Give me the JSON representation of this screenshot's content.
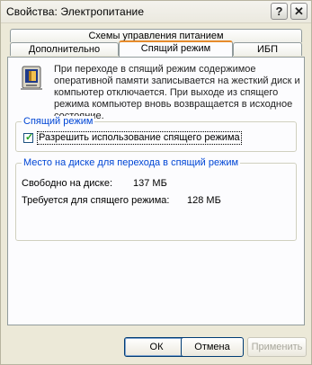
{
  "window": {
    "title": "Свойства: Электропитание",
    "help_glyph": "?",
    "close_glyph": "✕"
  },
  "tabs": {
    "row1": [
      {
        "label": "Схемы управления питанием"
      }
    ],
    "row2": [
      {
        "label": "Дополнительно"
      },
      {
        "label": "Спящий режим"
      },
      {
        "label": "ИБП"
      }
    ],
    "active": "Спящий режим"
  },
  "description": "При переходе в спящий режим содержимое оперативной памяти записывается на жесткий диск и компьютер отключается. При выходе из спящего режима компьютер вновь возвращается в исходное состояние.",
  "hibernate_group": {
    "title": "Спящий режим",
    "checkbox_label": "Разрешить использование спящего режима",
    "checked": true
  },
  "disk_group": {
    "title": "Место на диске для перехода в спящий режим",
    "free_label": "Свободно на диске:",
    "free_value": "137 МБ",
    "required_label": "Требуется для спящего режима:",
    "required_value": "128 МБ"
  },
  "buttons": {
    "ok": "ОК",
    "cancel": "Отмена",
    "apply": "Применить"
  }
}
